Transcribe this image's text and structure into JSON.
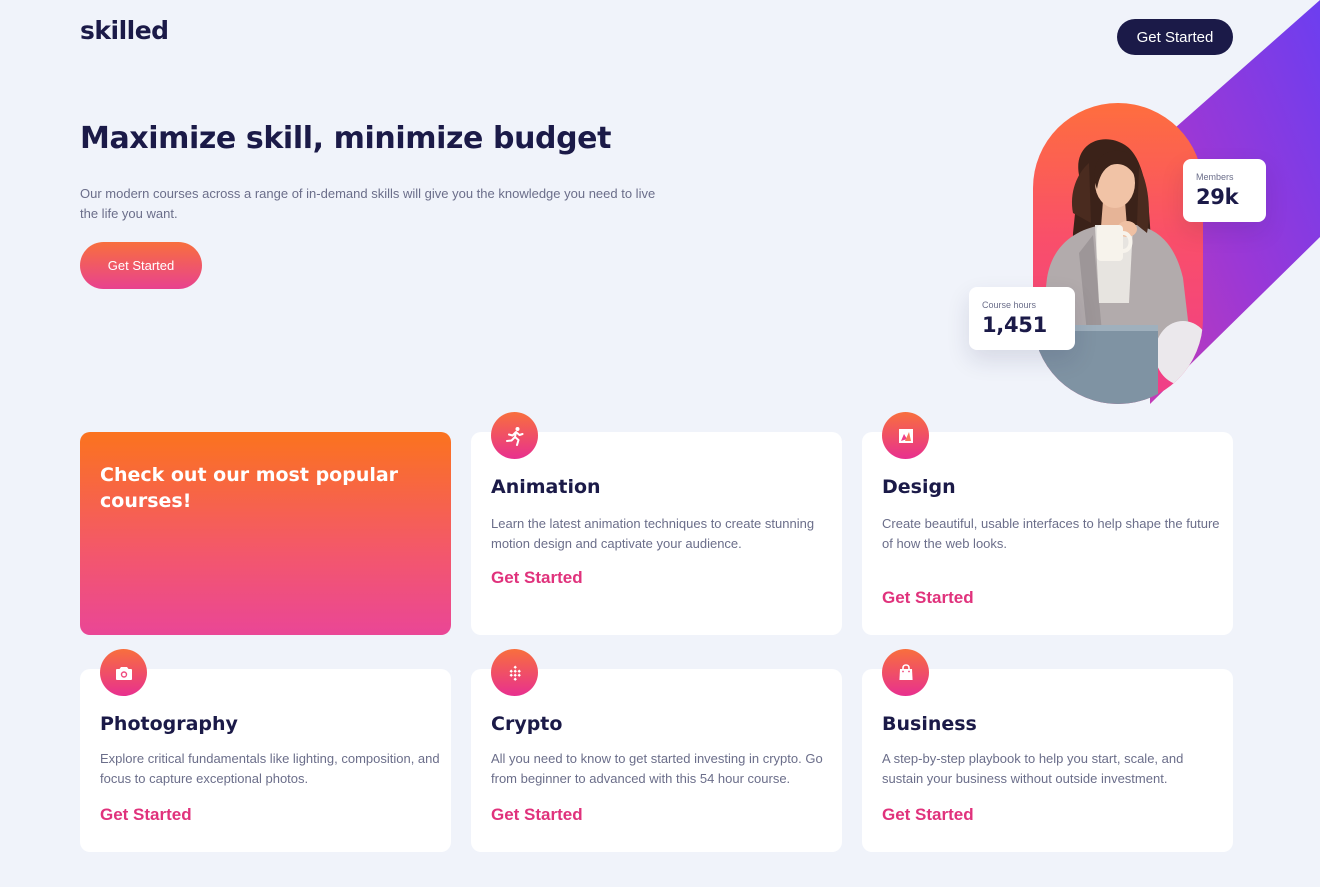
{
  "brand": {
    "logo": "skilled"
  },
  "nav": {
    "cta_label": "Get Started"
  },
  "hero": {
    "title": "Maximize skill, minimize budget",
    "subtitle": "Our modern courses across a range of in-demand skills will give you the knowledge you need to live the life you want.",
    "cta_label": "Get Started",
    "stats": [
      {
        "label": "Members",
        "value": "29k"
      },
      {
        "label": "Course hours",
        "value": "1,451"
      }
    ]
  },
  "promo": {
    "title": "Check out our most popular courses!"
  },
  "courses": [
    {
      "title": "Animation",
      "description": "Learn the latest animation techniques to create stunning motion design and captivate your audience.",
      "link": "Get Started",
      "icon": "running-person-icon"
    },
    {
      "title": "Design",
      "description": "Create beautiful, usable interfaces to help shape the future of how the web looks.",
      "link": "Get Started",
      "icon": "design-icon"
    },
    {
      "title": "Photography",
      "description": "Explore critical fundamentals like lighting, composition, and focus to capture exceptional photos.",
      "link": "Get Started",
      "icon": "camera-icon"
    },
    {
      "title": "Crypto",
      "description": "All you need to know to get started investing in crypto. Go from beginner to advanced with this 54 hour course.",
      "link": "Get Started",
      "icon": "crypto-icon"
    },
    {
      "title": "Business",
      "description": "A step-by-step playbook to help you start, scale, and sustain your business without outside investment.",
      "link": "Get Started",
      "icon": "shopping-bag-icon"
    }
  ],
  "colors": {
    "navy": "#1b1a48",
    "background": "#f0f3fa",
    "accent_pink": "#e0327c",
    "gradient_orange": "#fb731e",
    "gradient_pink": "#ea4696",
    "diagonal_purple": "#6c3ef0"
  }
}
